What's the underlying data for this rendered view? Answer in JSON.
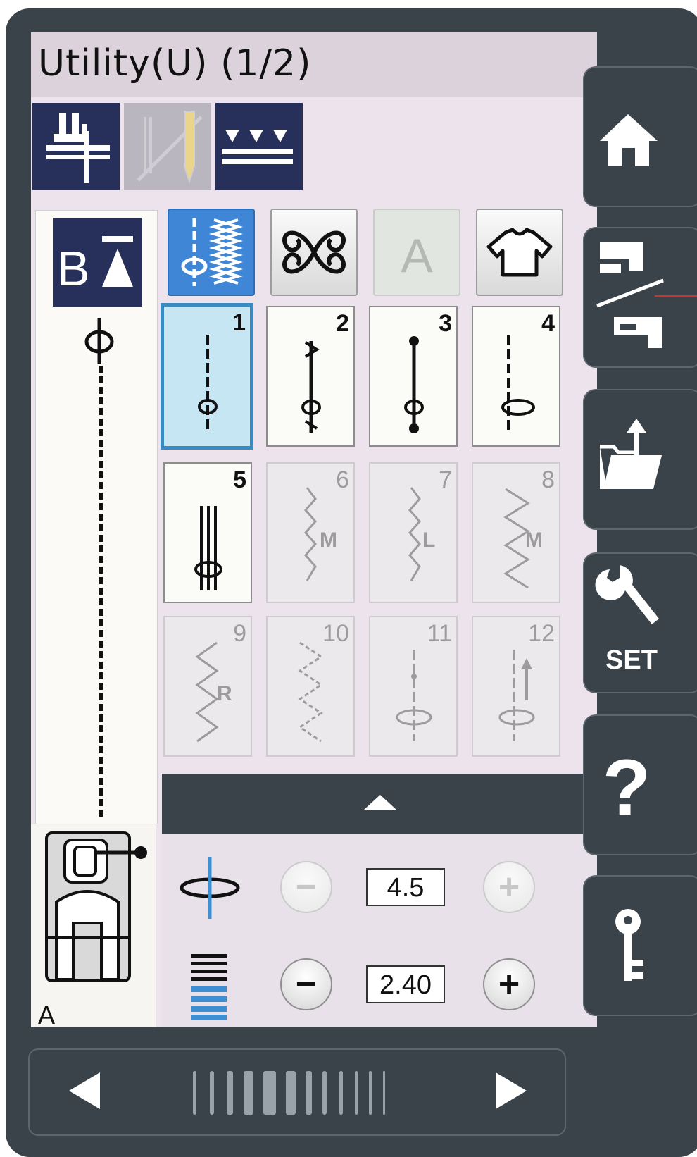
{
  "title": "Utility(U) (1/2)",
  "foot_label": "A",
  "categories": [
    {
      "name": "utility-stitches",
      "state": "active"
    },
    {
      "name": "decorative-stitches",
      "state": "normal"
    },
    {
      "name": "letters",
      "label": "A",
      "state": "disabled"
    },
    {
      "name": "garment-stitches",
      "state": "normal"
    }
  ],
  "stitches": [
    {
      "num": "1",
      "state": "selected"
    },
    {
      "num": "2",
      "state": "enabled"
    },
    {
      "num": "3",
      "state": "enabled"
    },
    {
      "num": "4",
      "state": "enabled"
    },
    {
      "num": "5",
      "state": "enabled"
    },
    {
      "num": "6",
      "mark": "M",
      "state": "disabled"
    },
    {
      "num": "7",
      "mark": "L",
      "state": "disabled"
    },
    {
      "num": "8",
      "mark": "M",
      "state": "disabled"
    },
    {
      "num": "9",
      "mark": "R",
      "state": "disabled"
    },
    {
      "num": "10",
      "state": "disabled"
    },
    {
      "num": "11",
      "state": "disabled"
    },
    {
      "num": "12",
      "state": "disabled"
    }
  ],
  "settings": {
    "needle_position": "4.5",
    "stitch_length": "2.40"
  },
  "sidebar": {
    "set_label": "SET"
  },
  "colors": {
    "frame": "#3a434a",
    "screen": "#ede3ec",
    "dark_button": "#27305a",
    "active_category": "#3f86d6",
    "selected_stitch": "#c7e6f3"
  }
}
